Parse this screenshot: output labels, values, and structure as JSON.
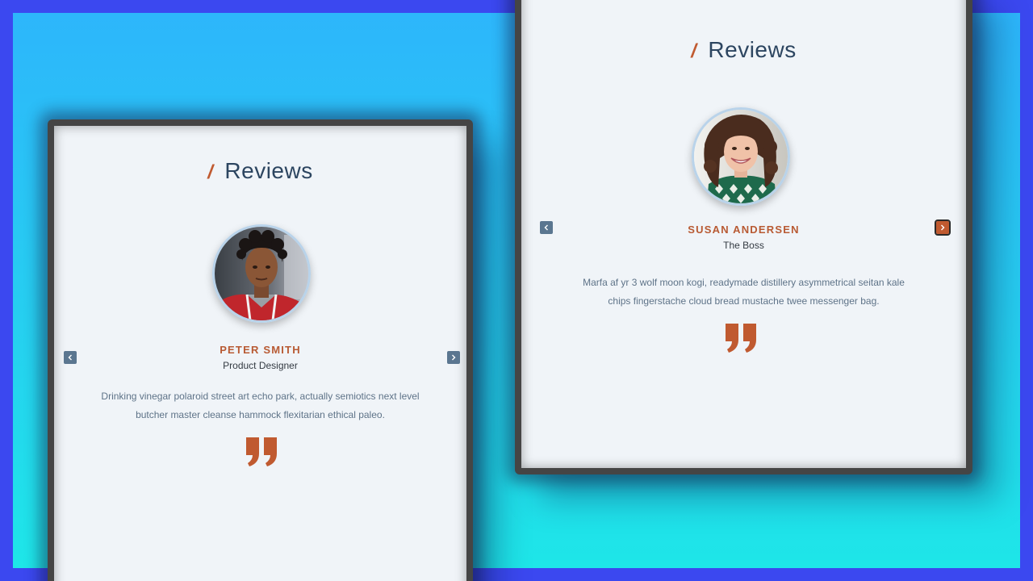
{
  "left_card": {
    "title_slash": "/",
    "title": "Reviews",
    "name": "PETER SMITH",
    "role": "Product Designer",
    "quote_line1": "Drinking vinegar polaroid street art echo park, actually semiotics next level",
    "quote_line2": "butcher master cleanse hammock flexitarian ethical paleo."
  },
  "right_card": {
    "title_slash": "/",
    "title": "Reviews",
    "name": "SUSAN ANDERSEN",
    "role": "The Boss",
    "quote_line1": "Marfa af yr 3 wolf moon kogi, readymade distillery asymmetrical seitan kale",
    "quote_line2": "chips fingerstache cloud bread mustache twee messenger bag."
  },
  "icons": {
    "prev": "chevron-left-icon",
    "next": "chevron-right-icon",
    "quote": "quote-icon"
  },
  "colors": {
    "accent": "#c05a30",
    "title": "#2c4560",
    "nav_button": "#5a7690",
    "panel_bg": "#f0f4f8",
    "outer_bg": "#3b48f0"
  }
}
